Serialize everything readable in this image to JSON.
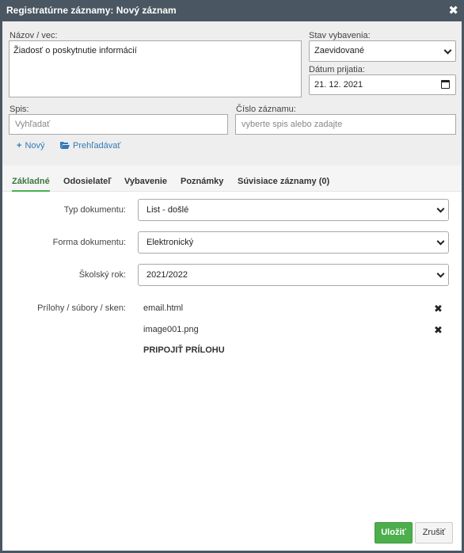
{
  "dialog": {
    "title": "Registratúrne záznamy: Nový záznam",
    "close_glyph": "✖"
  },
  "form": {
    "subject": {
      "label": "Názov / vec:",
      "value": "Žiadosť o poskytnutie informácií"
    },
    "status": {
      "label": "Stav vybavenia:",
      "value": "Zaevidované"
    },
    "received": {
      "label": "Dátum prijatia:",
      "value": "21. 12. 2021"
    },
    "file": {
      "label": "Spis:",
      "placeholder": "Vyhľadať"
    },
    "record_no": {
      "label": "Číslo záznamu:",
      "placeholder": "vyberte spis alebo zadajte"
    },
    "new_btn": {
      "icon": "+",
      "label": "Nový"
    },
    "browse_btn": {
      "icon": "folder-open-icon",
      "label": "Prehľadávať"
    }
  },
  "tabs": [
    {
      "label": "Základné"
    },
    {
      "label": "Odosielateľ"
    },
    {
      "label": "Vybavenie"
    },
    {
      "label": "Poznámky"
    },
    {
      "label": "Súvisiace záznamy (0)"
    }
  ],
  "basic": {
    "doc_type": {
      "label": "Typ dokumentu:",
      "value": "List - došlé"
    },
    "doc_form": {
      "label": "Forma dokumentu:",
      "value": "Elektronický"
    },
    "school_year": {
      "label": "Školský rok:",
      "value": "2021/2022"
    },
    "attachments": {
      "label": "Prílohy / súbory / sken:",
      "files": [
        "email.html",
        "image001.png"
      ],
      "attach_label": "PRIPOJIŤ PRÍLOHU",
      "remove_glyph": "✖"
    }
  },
  "footer": {
    "save_label": "Uložiť",
    "cancel_label": "Zrušiť"
  },
  "colors": {
    "titlebar": "#4a5661",
    "accent": "#4cae4c",
    "link": "#337ab7"
  }
}
